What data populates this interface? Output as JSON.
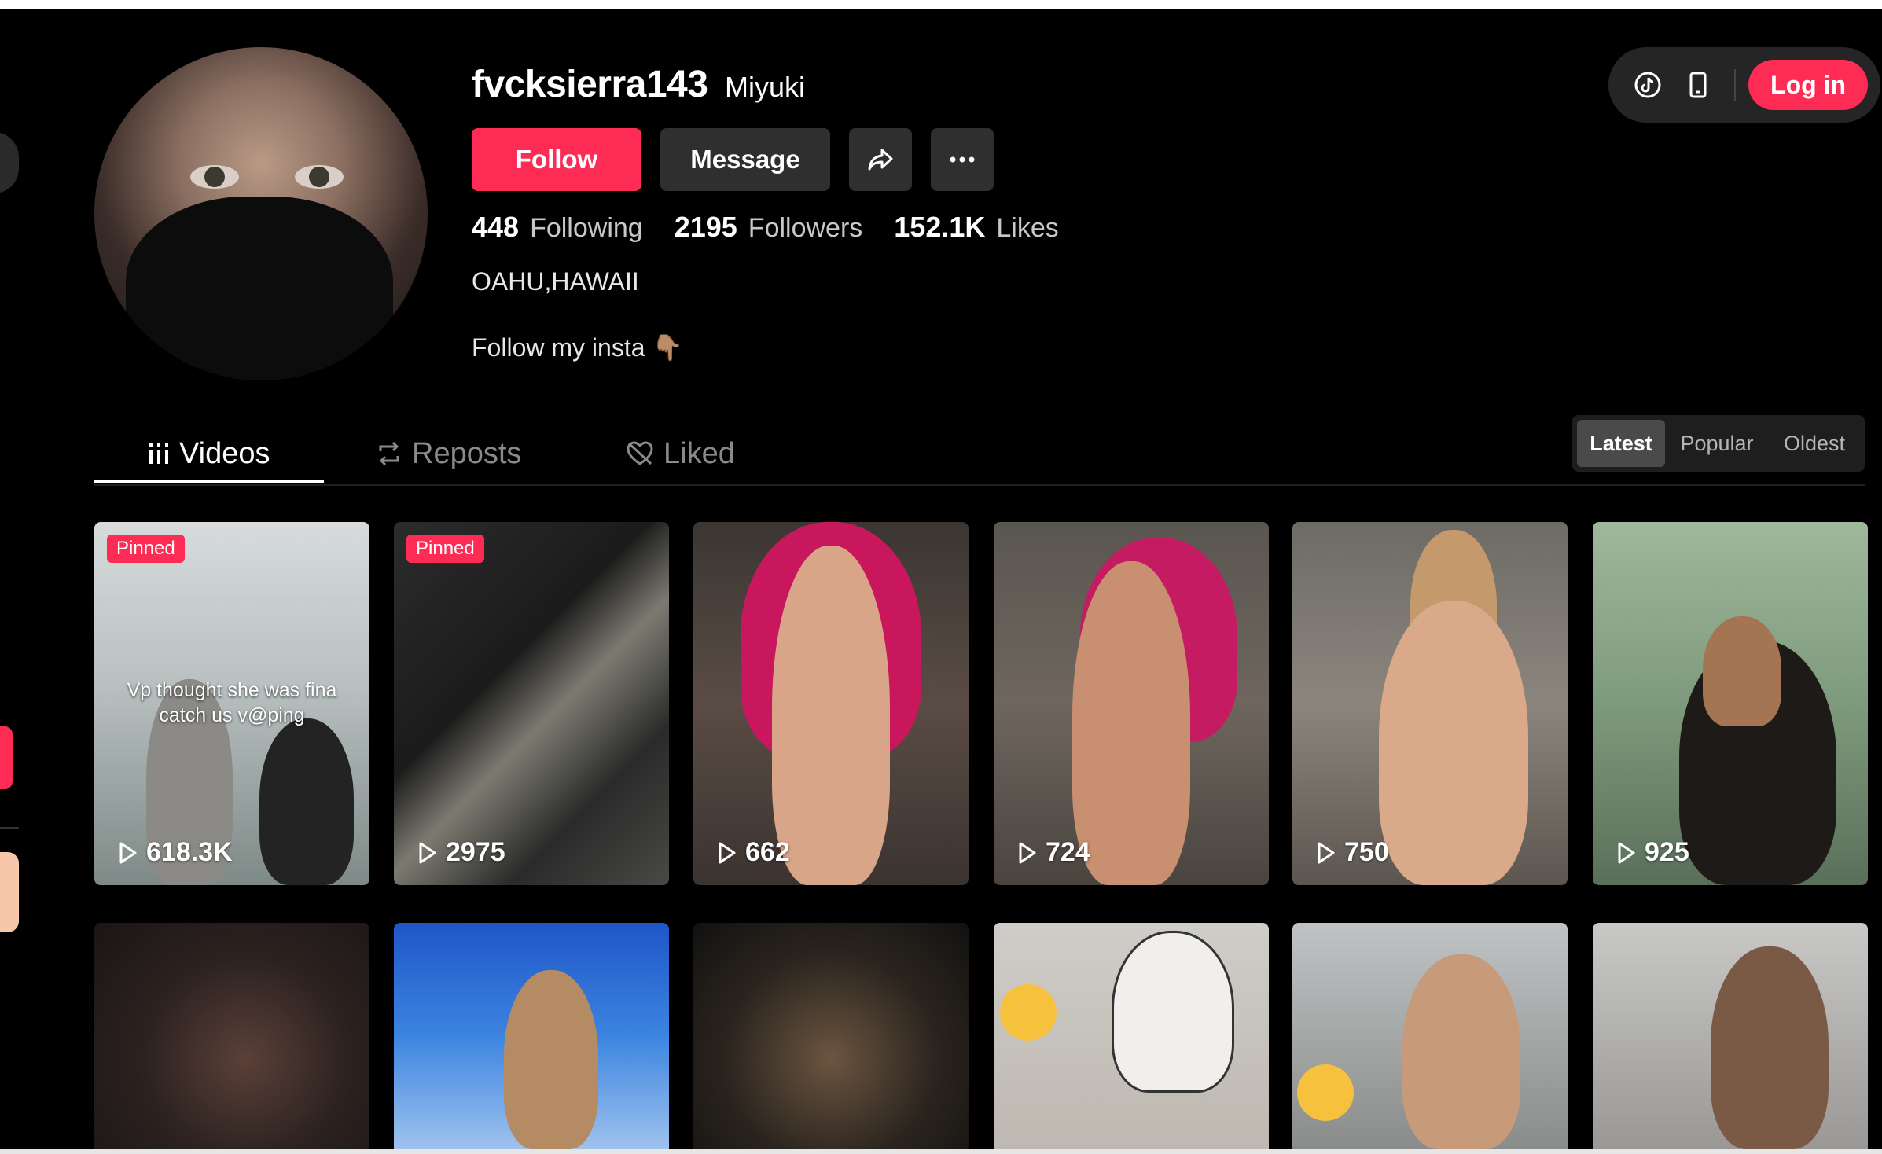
{
  "profile": {
    "username": "fvcksierra143",
    "nickname": "Miyuki",
    "location": "OAHU,HAWAII",
    "bio": "Follow my insta 👇🏽"
  },
  "actions": {
    "follow_label": "Follow",
    "message_label": "Message"
  },
  "stats": [
    {
      "value": "448",
      "label": "Following"
    },
    {
      "value": "2195",
      "label": "Followers"
    },
    {
      "value": "152.1K",
      "label": "Likes"
    }
  ],
  "header": {
    "login_label": "Log in"
  },
  "tabs": [
    {
      "label": "Videos",
      "icon": "grid-bars-icon",
      "active": true
    },
    {
      "label": "Reposts",
      "icon": "repost-icon",
      "active": false
    },
    {
      "label": "Liked",
      "icon": "hidden-heart-icon",
      "active": false
    }
  ],
  "sort": [
    "Latest",
    "Popular",
    "Oldest"
  ],
  "sort_selected": "Latest",
  "videos": [
    {
      "views": "618.3K",
      "badge": "Pinned",
      "caption": "Vp thought she was fina catch us v@ping"
    },
    {
      "views": "2975",
      "badge": "Pinned"
    },
    {
      "views": "662"
    },
    {
      "views": "724"
    },
    {
      "views": "750"
    },
    {
      "views": "925"
    }
  ],
  "colors": {
    "accent": "#fe2c55",
    "background": "#000000",
    "button_dark": "#2f2f2f"
  }
}
